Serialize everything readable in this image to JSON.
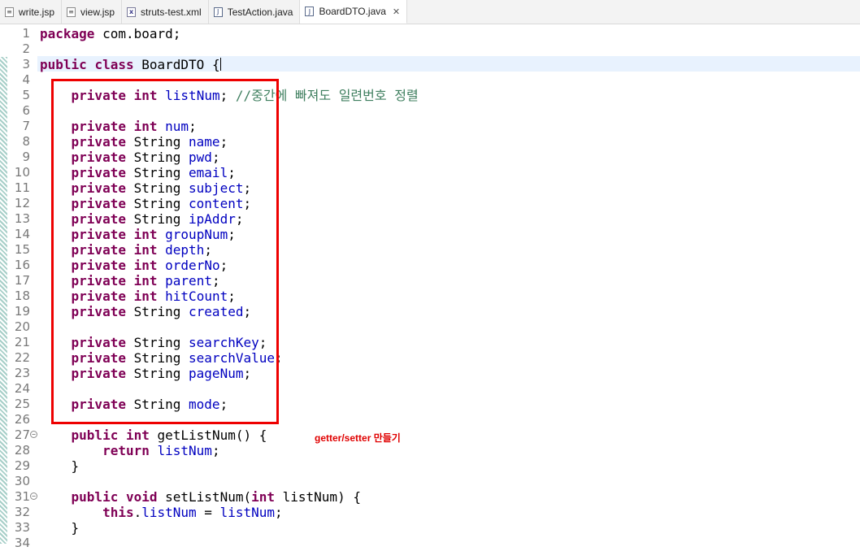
{
  "tabs": [
    {
      "label": "write.jsp",
      "icon": "jsp-file-icon"
    },
    {
      "label": "view.jsp",
      "icon": "jsp-file-icon"
    },
    {
      "label": "struts-test.xml",
      "icon": "xml-file-icon"
    },
    {
      "label": "TestAction.java",
      "icon": "java-file-icon"
    },
    {
      "label": "BoardDTO.java",
      "icon": "java-file-icon",
      "active": true
    }
  ],
  "editor": {
    "current_line": 3,
    "lines": [
      {
        "n": "1",
        "code": "package com.board;"
      },
      {
        "n": "2",
        "code": ""
      },
      {
        "n": "3",
        "code": "public class BoardDTO {"
      },
      {
        "n": "4",
        "code": ""
      },
      {
        "n": "5",
        "code": "    private int listNum; //중간에 빠져도 일련번호 정렬"
      },
      {
        "n": "6",
        "code": ""
      },
      {
        "n": "7",
        "code": "    private int num;"
      },
      {
        "n": "8",
        "code": "    private String name;"
      },
      {
        "n": "9",
        "code": "    private String pwd;"
      },
      {
        "n": "10",
        "code": "    private String email;"
      },
      {
        "n": "11",
        "code": "    private String subject;"
      },
      {
        "n": "12",
        "code": "    private String content;"
      },
      {
        "n": "13",
        "code": "    private String ipAddr;"
      },
      {
        "n": "14",
        "code": "    private int groupNum;"
      },
      {
        "n": "15",
        "code": "    private int depth;"
      },
      {
        "n": "16",
        "code": "    private int orderNo;"
      },
      {
        "n": "17",
        "code": "    private int parent;"
      },
      {
        "n": "18",
        "code": "    private int hitCount;"
      },
      {
        "n": "19",
        "code": "    private String created;"
      },
      {
        "n": "20",
        "code": ""
      },
      {
        "n": "21",
        "code": "    private String searchKey;"
      },
      {
        "n": "22",
        "code": "    private String searchValue;"
      },
      {
        "n": "23",
        "code": "    private String pageNum;"
      },
      {
        "n": "24",
        "code": ""
      },
      {
        "n": "25",
        "code": "    private String mode;"
      },
      {
        "n": "26",
        "code": ""
      },
      {
        "n": "27",
        "code": "    public int getListNum() {",
        "fold": true
      },
      {
        "n": "28",
        "code": "        return listNum;"
      },
      {
        "n": "29",
        "code": "    }"
      },
      {
        "n": "30",
        "code": ""
      },
      {
        "n": "31",
        "code": "    public void setListNum(int listNum) {",
        "fold": true
      },
      {
        "n": "32",
        "code": "        this.listNum = listNum;"
      },
      {
        "n": "33",
        "code": "    }"
      },
      {
        "n": "34",
        "code": ""
      }
    ]
  },
  "annotation": {
    "text": "getter/setter 만들기",
    "color": "#e00000"
  },
  "colors": {
    "keyword": "#7f0055",
    "field": "#0000c0",
    "comment": "#3f7f5f",
    "annotation_box": "#ee0000",
    "current_line": "#e8f2fe"
  }
}
